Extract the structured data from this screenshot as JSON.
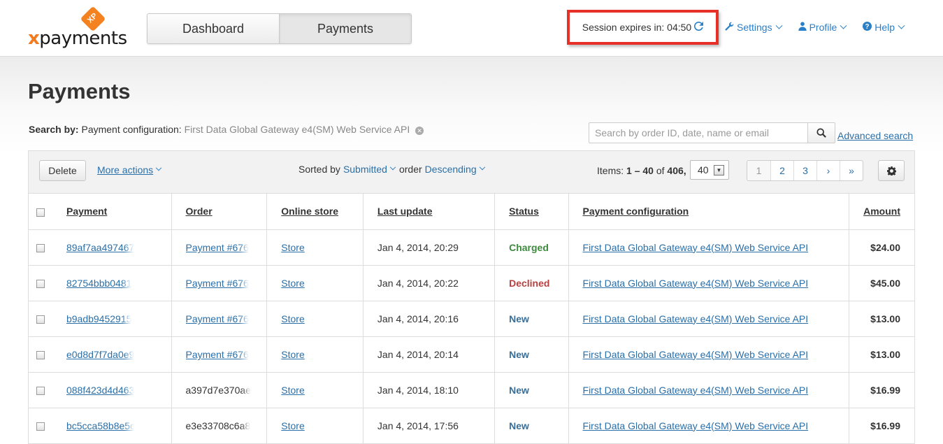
{
  "logo": {
    "text_x": "x",
    "text_rest": "payments",
    "badge": "XP"
  },
  "nav": {
    "tabs": [
      {
        "label": "Dashboard"
      },
      {
        "label": "Payments"
      }
    ]
  },
  "session": {
    "label": "Session expires in: 04:50"
  },
  "top_links": {
    "settings": "Settings",
    "profile": "Profile",
    "help": "Help"
  },
  "page": {
    "title": "Payments"
  },
  "search": {
    "by_label": "Search by:",
    "filter_name": "Payment configuration:",
    "filter_value": "First Data Global Gateway e4(SM) Web Service API",
    "placeholder": "Search by order ID, date, name or email",
    "advanced": "Advanced search"
  },
  "toolbar": {
    "delete": "Delete",
    "more_actions": "More actions",
    "sorted_by": "Sorted by",
    "sort_field": "Submitted",
    "order_label": "order",
    "order_value": "Descending",
    "items_label": "Items:",
    "items_range": "1 – 40",
    "items_of": "of",
    "items_total": "406,",
    "per_page": "40",
    "pages": [
      "1",
      "2",
      "3",
      "›",
      "»"
    ]
  },
  "table": {
    "columns": [
      "Payment",
      "Order",
      "Online store",
      "Last update",
      "Status",
      "Payment configuration",
      "Amount"
    ],
    "rows": [
      {
        "payment": "89af7aa497467",
        "order": "Payment #676",
        "order_link": true,
        "store": "Store",
        "updated": "Jan 4, 2014, 20:29",
        "status": "Charged",
        "status_color": "#3d8a3d",
        "config": "First Data Global Gateway e4(SM) Web Service API",
        "amount": "$24.00"
      },
      {
        "payment": "82754bbb0481",
        "order": "Payment #676",
        "order_link": true,
        "store": "Store",
        "updated": "Jan 4, 2014, 20:22",
        "status": "Declined",
        "status_color": "#b84040",
        "config": "First Data Global Gateway e4(SM) Web Service API",
        "amount": "$45.00"
      },
      {
        "payment": "b9adb9452915",
        "order": "Payment #676",
        "order_link": true,
        "store": "Store",
        "updated": "Jan 4, 2014, 20:16",
        "status": "New",
        "status_color": "#3a6e96",
        "config": "First Data Global Gateway e4(SM) Web Service API",
        "amount": "$13.00"
      },
      {
        "payment": "e0d8d7f7da0e9",
        "order": "Payment #676",
        "order_link": true,
        "store": "Store",
        "updated": "Jan 4, 2014, 20:14",
        "status": "New",
        "status_color": "#3a6e96",
        "config": "First Data Global Gateway e4(SM) Web Service API",
        "amount": "$13.00"
      },
      {
        "payment": "088f423d4d463",
        "order": "a397d7e370ae",
        "order_link": false,
        "store": "Store",
        "updated": "Jan 4, 2014, 18:10",
        "status": "New",
        "status_color": "#3a6e96",
        "config": "First Data Global Gateway e4(SM) Web Service API",
        "amount": "$16.99"
      },
      {
        "payment": "bc5cca58b8e5c",
        "order": "e3e33708c6a8",
        "order_link": false,
        "store": "Store",
        "updated": "Jan 4, 2014, 17:56",
        "status": "New",
        "status_color": "#3a6e96",
        "config": "First Data Global Gateway e4(SM) Web Service API",
        "amount": "$16.99"
      }
    ]
  }
}
